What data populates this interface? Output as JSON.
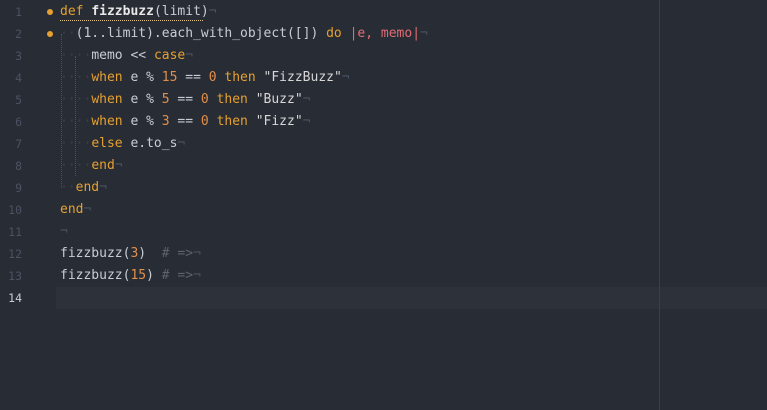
{
  "editor": {
    "current_line": 14,
    "wrap_guide_visible": true,
    "colors": {
      "background": "#282c34",
      "keyword": "#e5a031",
      "number": "#e0904a",
      "comment": "#5c6370",
      "modified_marker": "#e5a031"
    },
    "line_numbers": [
      "1",
      "2",
      "3",
      "4",
      "5",
      "6",
      "7",
      "8",
      "9",
      "10",
      "11",
      "12",
      "13",
      "14"
    ],
    "modified_lines": [
      1,
      2
    ],
    "invisible_glyphs": {
      "space": "·",
      "eol": "¬"
    },
    "lines": [
      [
        {
          "t": "def",
          "c": "def"
        },
        {
          "t": " ",
          "c": "ws"
        },
        {
          "t": "fizzbuzz",
          "c": "fn"
        },
        {
          "t": "(limit)",
          "c": "punc"
        },
        {
          "t": "¬",
          "c": "eol"
        }
      ],
      [
        {
          "t": "··",
          "c": "ws"
        },
        {
          "t": "(1..limit).each_with_object([]) ",
          "c": "ident"
        },
        {
          "t": "do",
          "c": "def"
        },
        {
          "t": " ",
          "c": "ws"
        },
        {
          "t": "|e, memo|",
          "c": "blockvar"
        },
        {
          "t": "¬",
          "c": "eol"
        }
      ],
      [
        {
          "t": "····",
          "c": "ws"
        },
        {
          "t": "memo << ",
          "c": "ident"
        },
        {
          "t": "case",
          "c": "def"
        },
        {
          "t": "¬",
          "c": "eol"
        }
      ],
      [
        {
          "t": "····",
          "c": "ws"
        },
        {
          "t": "when",
          "c": "def"
        },
        {
          "t": " e % ",
          "c": "ident"
        },
        {
          "t": "15",
          "c": "num"
        },
        {
          "t": " == ",
          "c": "ident"
        },
        {
          "t": "0",
          "c": "num"
        },
        {
          "t": " ",
          "c": "ws"
        },
        {
          "t": "then",
          "c": "def"
        },
        {
          "t": " \"FizzBuzz\"",
          "c": "str"
        },
        {
          "t": "¬",
          "c": "eol"
        }
      ],
      [
        {
          "t": "····",
          "c": "ws"
        },
        {
          "t": "when",
          "c": "def"
        },
        {
          "t": " e % ",
          "c": "ident"
        },
        {
          "t": "5",
          "c": "num"
        },
        {
          "t": " == ",
          "c": "ident"
        },
        {
          "t": "0",
          "c": "num"
        },
        {
          "t": " ",
          "c": "ws"
        },
        {
          "t": "then",
          "c": "def"
        },
        {
          "t": " \"Buzz\"",
          "c": "str"
        },
        {
          "t": "¬",
          "c": "eol"
        }
      ],
      [
        {
          "t": "····",
          "c": "ws"
        },
        {
          "t": "when",
          "c": "def"
        },
        {
          "t": " e % ",
          "c": "ident"
        },
        {
          "t": "3",
          "c": "num"
        },
        {
          "t": " == ",
          "c": "ident"
        },
        {
          "t": "0",
          "c": "num"
        },
        {
          "t": " ",
          "c": "ws"
        },
        {
          "t": "then",
          "c": "def"
        },
        {
          "t": " \"Fizz\"",
          "c": "str"
        },
        {
          "t": "¬",
          "c": "eol"
        }
      ],
      [
        {
          "t": "····",
          "c": "ws"
        },
        {
          "t": "else",
          "c": "def"
        },
        {
          "t": " e.to_s",
          "c": "ident"
        },
        {
          "t": "¬",
          "c": "eol"
        }
      ],
      [
        {
          "t": "····",
          "c": "ws"
        },
        {
          "t": "end",
          "c": "def"
        },
        {
          "t": "¬",
          "c": "eol"
        }
      ],
      [
        {
          "t": "··",
          "c": "ws"
        },
        {
          "t": "end",
          "c": "def"
        },
        {
          "t": "¬",
          "c": "eol"
        }
      ],
      [
        {
          "t": "end",
          "c": "def"
        },
        {
          "t": "¬",
          "c": "eol"
        }
      ],
      [
        {
          "t": "¬",
          "c": "eol"
        }
      ],
      [
        {
          "t": "fizzbuzz(",
          "c": "ident"
        },
        {
          "t": "3",
          "c": "num"
        },
        {
          "t": ")  ",
          "c": "ident"
        },
        {
          "t": "# =>",
          "c": "comment"
        },
        {
          "t": "¬",
          "c": "eol"
        }
      ],
      [
        {
          "t": "fizzbuzz(",
          "c": "ident"
        },
        {
          "t": "15",
          "c": "num"
        },
        {
          "t": ") ",
          "c": "ident"
        },
        {
          "t": "# =>",
          "c": "comment"
        },
        {
          "t": "¬",
          "c": "eol"
        }
      ],
      []
    ]
  }
}
